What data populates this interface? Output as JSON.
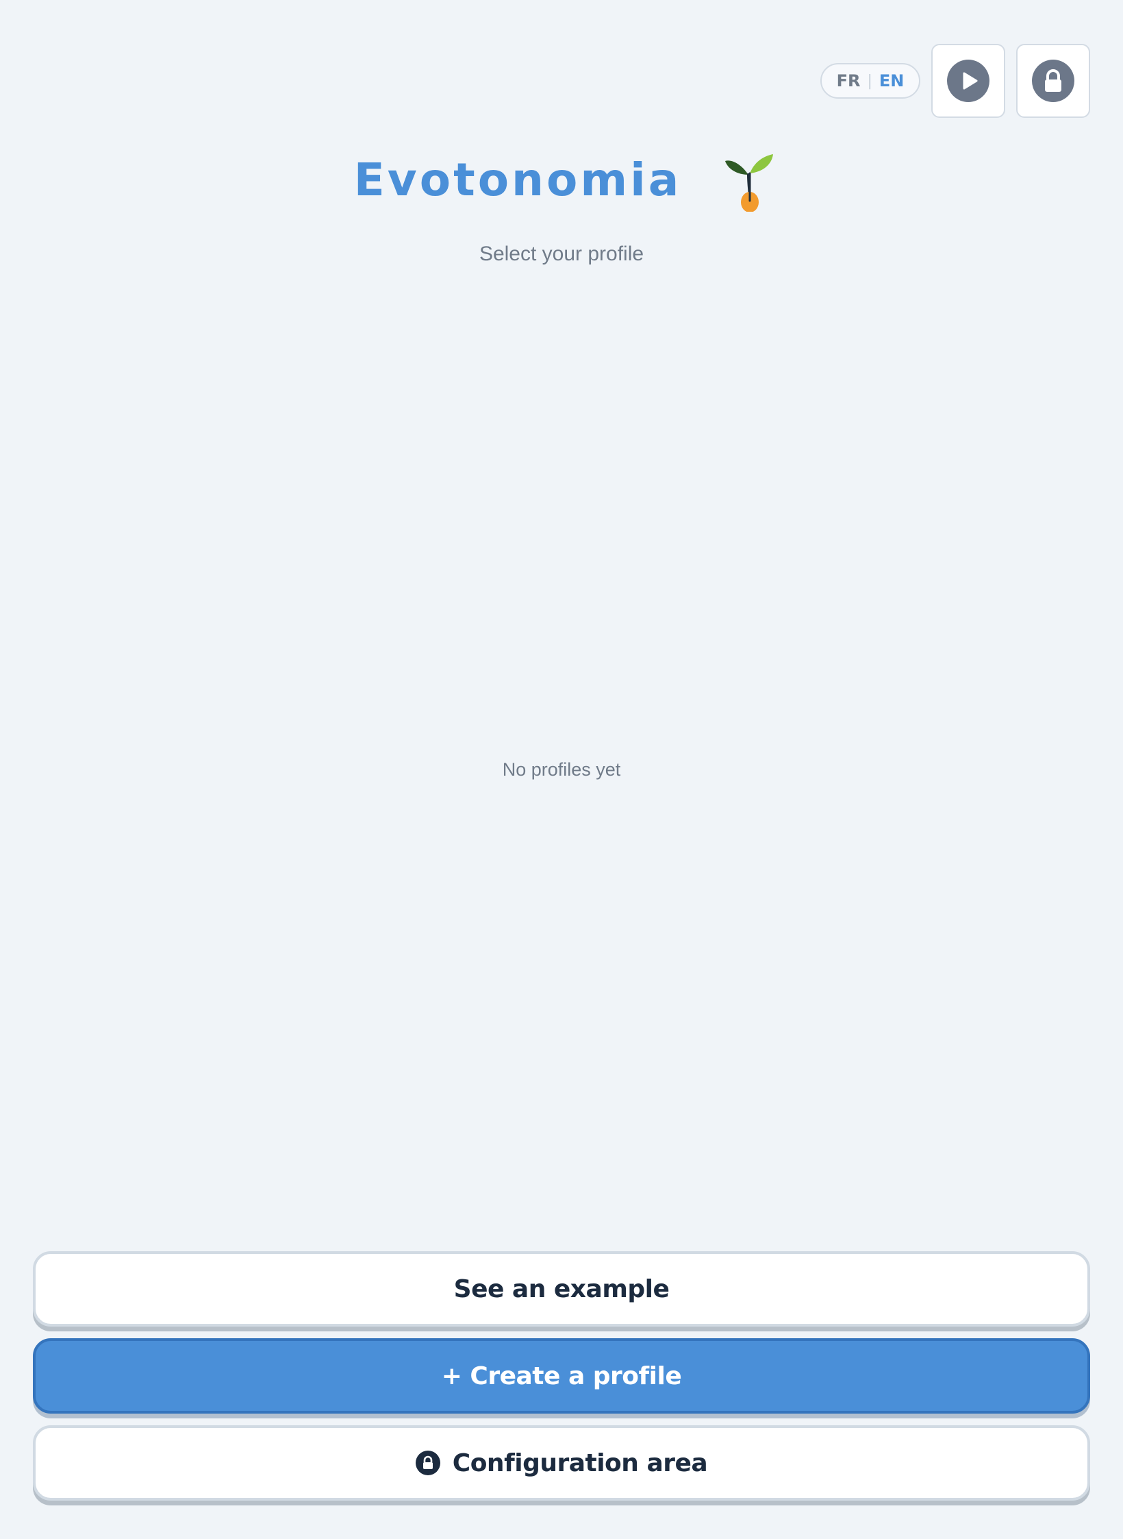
{
  "header": {
    "lang_fr": "FR",
    "lang_separator": "|",
    "lang_en": "EN",
    "active_language": "EN",
    "play_icon": "play-icon",
    "lock_icon": "lock-icon"
  },
  "main": {
    "title": "Evotonomia",
    "logo_icon": "sprout-icon",
    "subtitle": "Select your profile",
    "empty_message": "No profiles yet"
  },
  "actions": {
    "example_label": "See an example",
    "create_label": "+ Create a profile",
    "config_label": "Configuration area",
    "config_icon": "lock-icon"
  },
  "colors": {
    "accent": "#4a8fd8",
    "background": "#f0f4f8",
    "text_dark": "#1c2b3f",
    "text_muted": "#707b89",
    "icon_gray": "#6c7789"
  }
}
